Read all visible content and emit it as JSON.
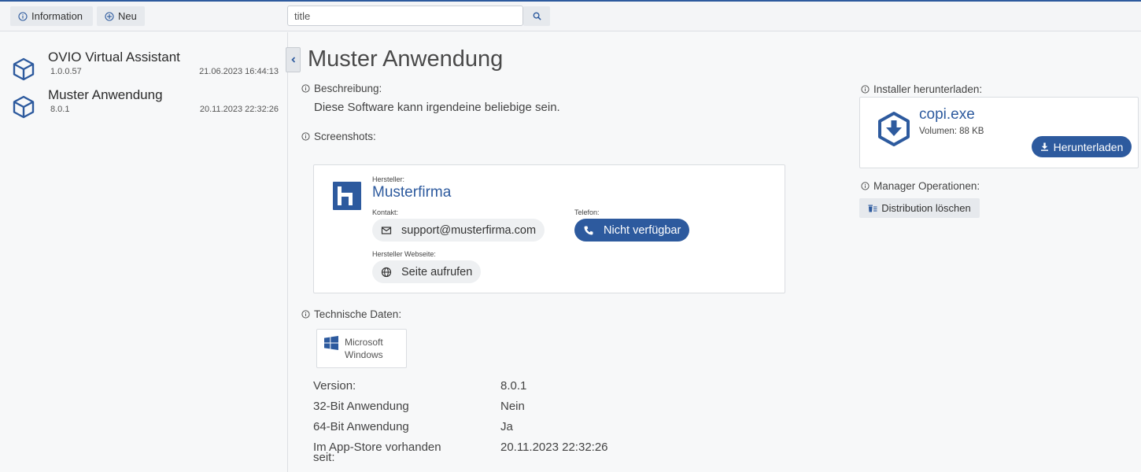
{
  "toolbar": {
    "info_label": "Information",
    "new_label": "Neu",
    "search_placeholder": "title"
  },
  "sidebar": {
    "items": [
      {
        "name": "OVIO Virtual Assistant",
        "version": "1.0.0.57",
        "date": "21.06.2023 16:44:13"
      },
      {
        "name": "Muster Anwendung",
        "version": "8.0.1",
        "date": "20.11.2023 22:32:26"
      }
    ]
  },
  "main": {
    "title": "Muster Anwendung",
    "description_label": "Beschreibung:",
    "description_text": "Diese Software kann irgendeine beliebige sein.",
    "screenshots_label": "Screenshots:",
    "vendor": {
      "label": "Hersteller:",
      "name": "Musterfirma",
      "contact_label": "Kontakt:",
      "email": "support@musterfirma.com",
      "phone_label": "Telefon:",
      "phone": "Nicht verfügbar",
      "website_label": "Hersteller Webseite:",
      "website_button": "Seite aufrufen"
    },
    "tech_label": "Technische Daten:",
    "os": "Microsoft Windows",
    "tech_rows": [
      {
        "key": "Version:",
        "value": "8.0.1"
      },
      {
        "key": "32-Bit Anwendung",
        "value": "Nein"
      },
      {
        "key": "64-Bit Anwendung",
        "value": "Ja"
      },
      {
        "key": "Im App-Store vorhanden seit:",
        "value": "20.11.2023 22:32:26"
      }
    ]
  },
  "right": {
    "installer_label": "Installer herunterladen:",
    "file_name": "copi.exe",
    "volume": "Volumen: 88 KB",
    "download_button": "Herunterladen",
    "manager_label": "Manager Operationen:",
    "delete_button": "Distribution löschen"
  },
  "colors": {
    "accent": "#2d5a9e"
  }
}
